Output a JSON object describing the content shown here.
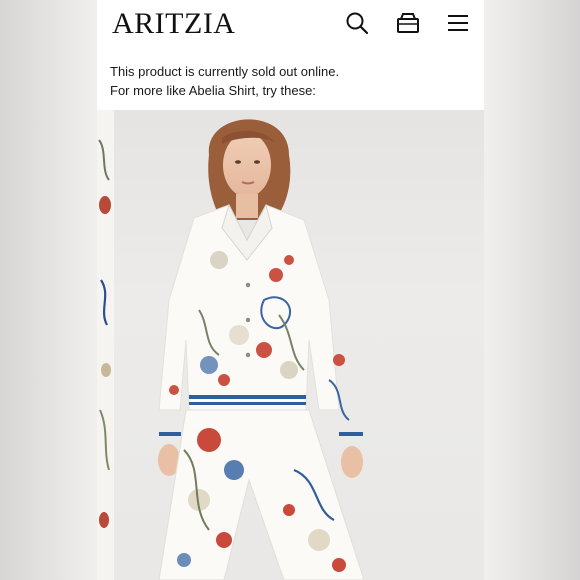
{
  "header": {
    "logo": "ARITZIA",
    "icons": [
      "search-icon",
      "bag-icon",
      "menu-icon"
    ]
  },
  "notice": {
    "line1": "This product is currently sold out online.",
    "line2": "For more like Abelia Shirt, try these:"
  },
  "colors": {
    "text": "#111111",
    "background": "#ffffff",
    "stripe_blue": "#2f5e9e",
    "floral_red": "#c94a3a"
  }
}
